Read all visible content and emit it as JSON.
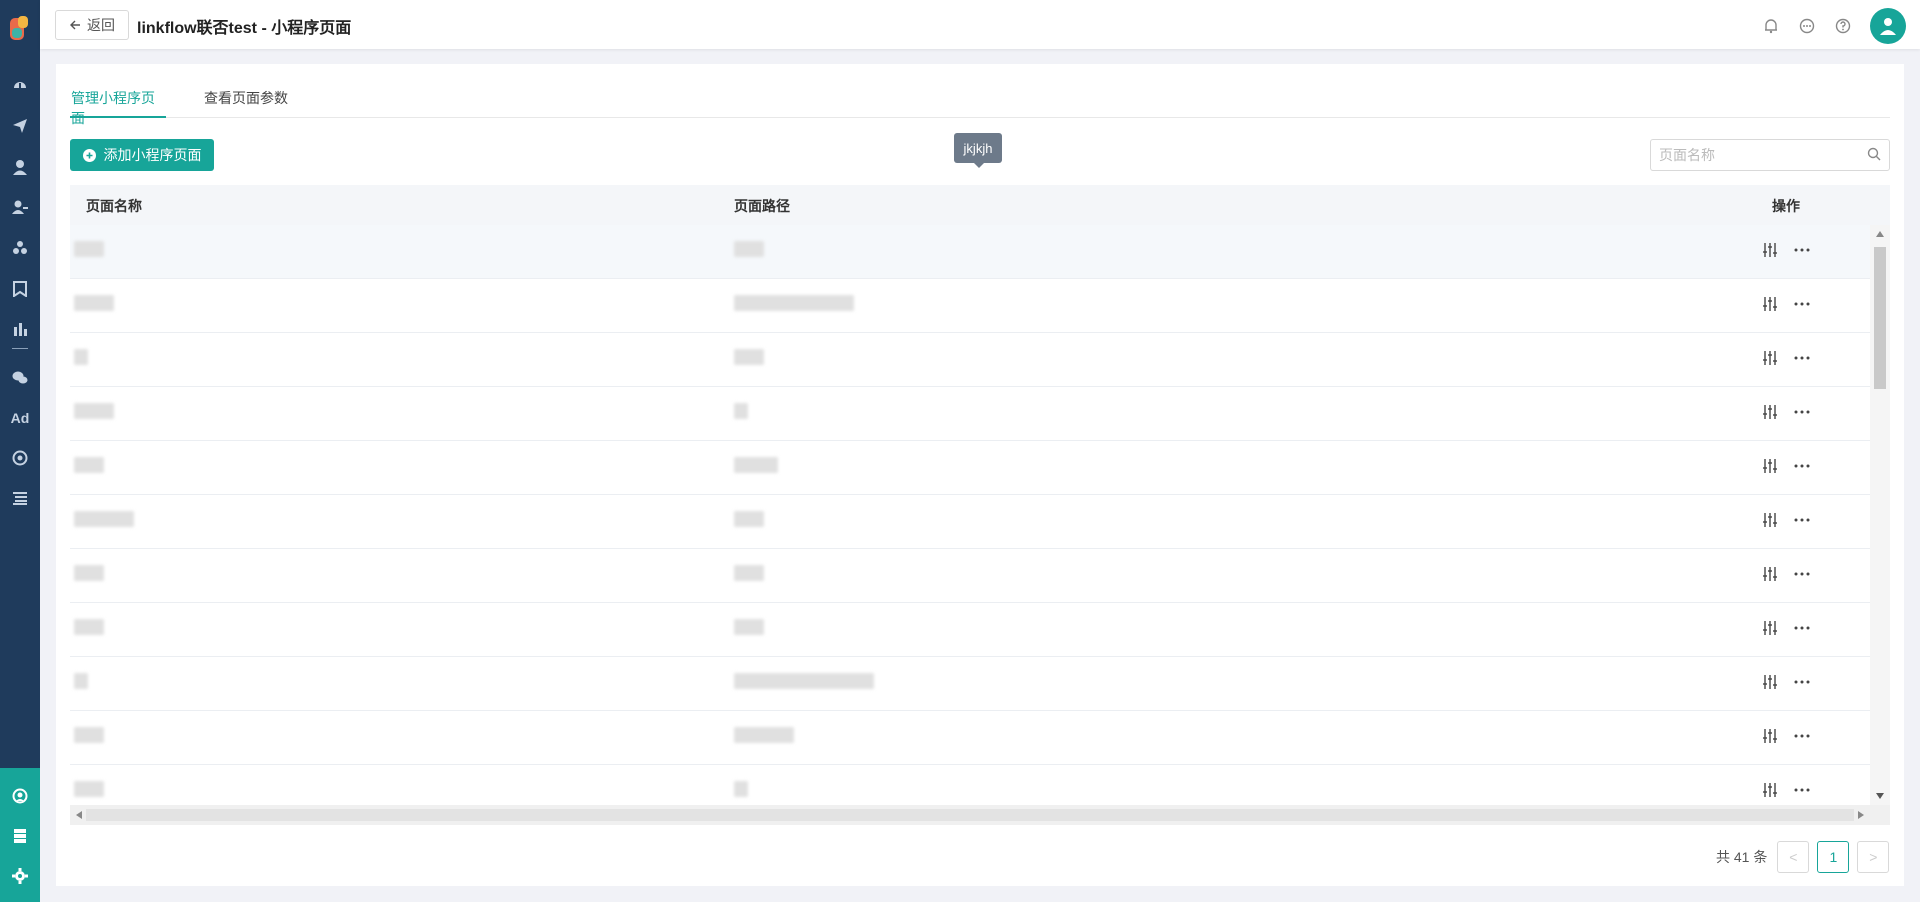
{
  "header": {
    "back_label": "返回",
    "title": "linkflow联否test - 小程序页面"
  },
  "sidebar": {
    "icons": [
      "dashboard-icon",
      "send-icon",
      "user-icon",
      "users-icon",
      "segments-icon",
      "bookmark-icon",
      "bar-chart-icon",
      "wechat-icon",
      "ad-icon",
      "target-icon",
      "list-icon"
    ],
    "ad_label": "Ad",
    "bottom_icons": [
      "support-icon",
      "server-icon",
      "settings-icon"
    ]
  },
  "tabs": [
    {
      "label": "管理小程序页面",
      "active": true
    },
    {
      "label": "查看页面参数",
      "active": false
    }
  ],
  "toolbar": {
    "add_label": "添加小程序页面",
    "search_placeholder": "页面名称"
  },
  "table": {
    "columns": [
      "页面名称",
      "页面路径",
      "操作"
    ],
    "row_count_visible": 11
  },
  "tooltip": {
    "text": "jkjkjh"
  },
  "pagination": {
    "total": "共 41 条",
    "prev": "<",
    "current": "1",
    "next": ">"
  },
  "colors": {
    "accent": "#17a599",
    "sidebar": "#1f3b5c"
  }
}
